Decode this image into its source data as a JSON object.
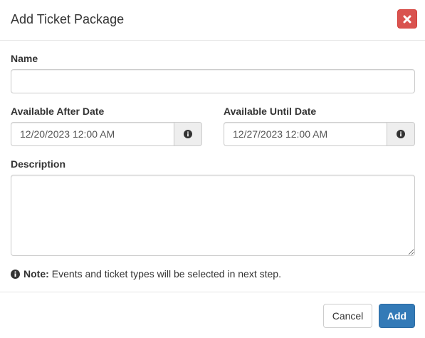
{
  "header": {
    "title": "Add Ticket Package"
  },
  "form": {
    "name": {
      "label": "Name",
      "value": ""
    },
    "available_after": {
      "label": "Available After Date",
      "value": "12/20/2023 12:00 AM"
    },
    "available_until": {
      "label": "Available Until Date",
      "value": "12/27/2023 12:00 AM"
    },
    "description": {
      "label": "Description",
      "value": ""
    }
  },
  "note": {
    "prefix": "Note:",
    "text": "Events and ticket types will be selected in next step."
  },
  "footer": {
    "cancel_label": "Cancel",
    "add_label": "Add"
  },
  "colors": {
    "close_button": "#d9534f",
    "primary": "#337ab7",
    "addon_bg": "#eeeeee",
    "border": "#cccccc"
  },
  "icons": {
    "close": "close-icon",
    "info": "info-circle-icon"
  }
}
